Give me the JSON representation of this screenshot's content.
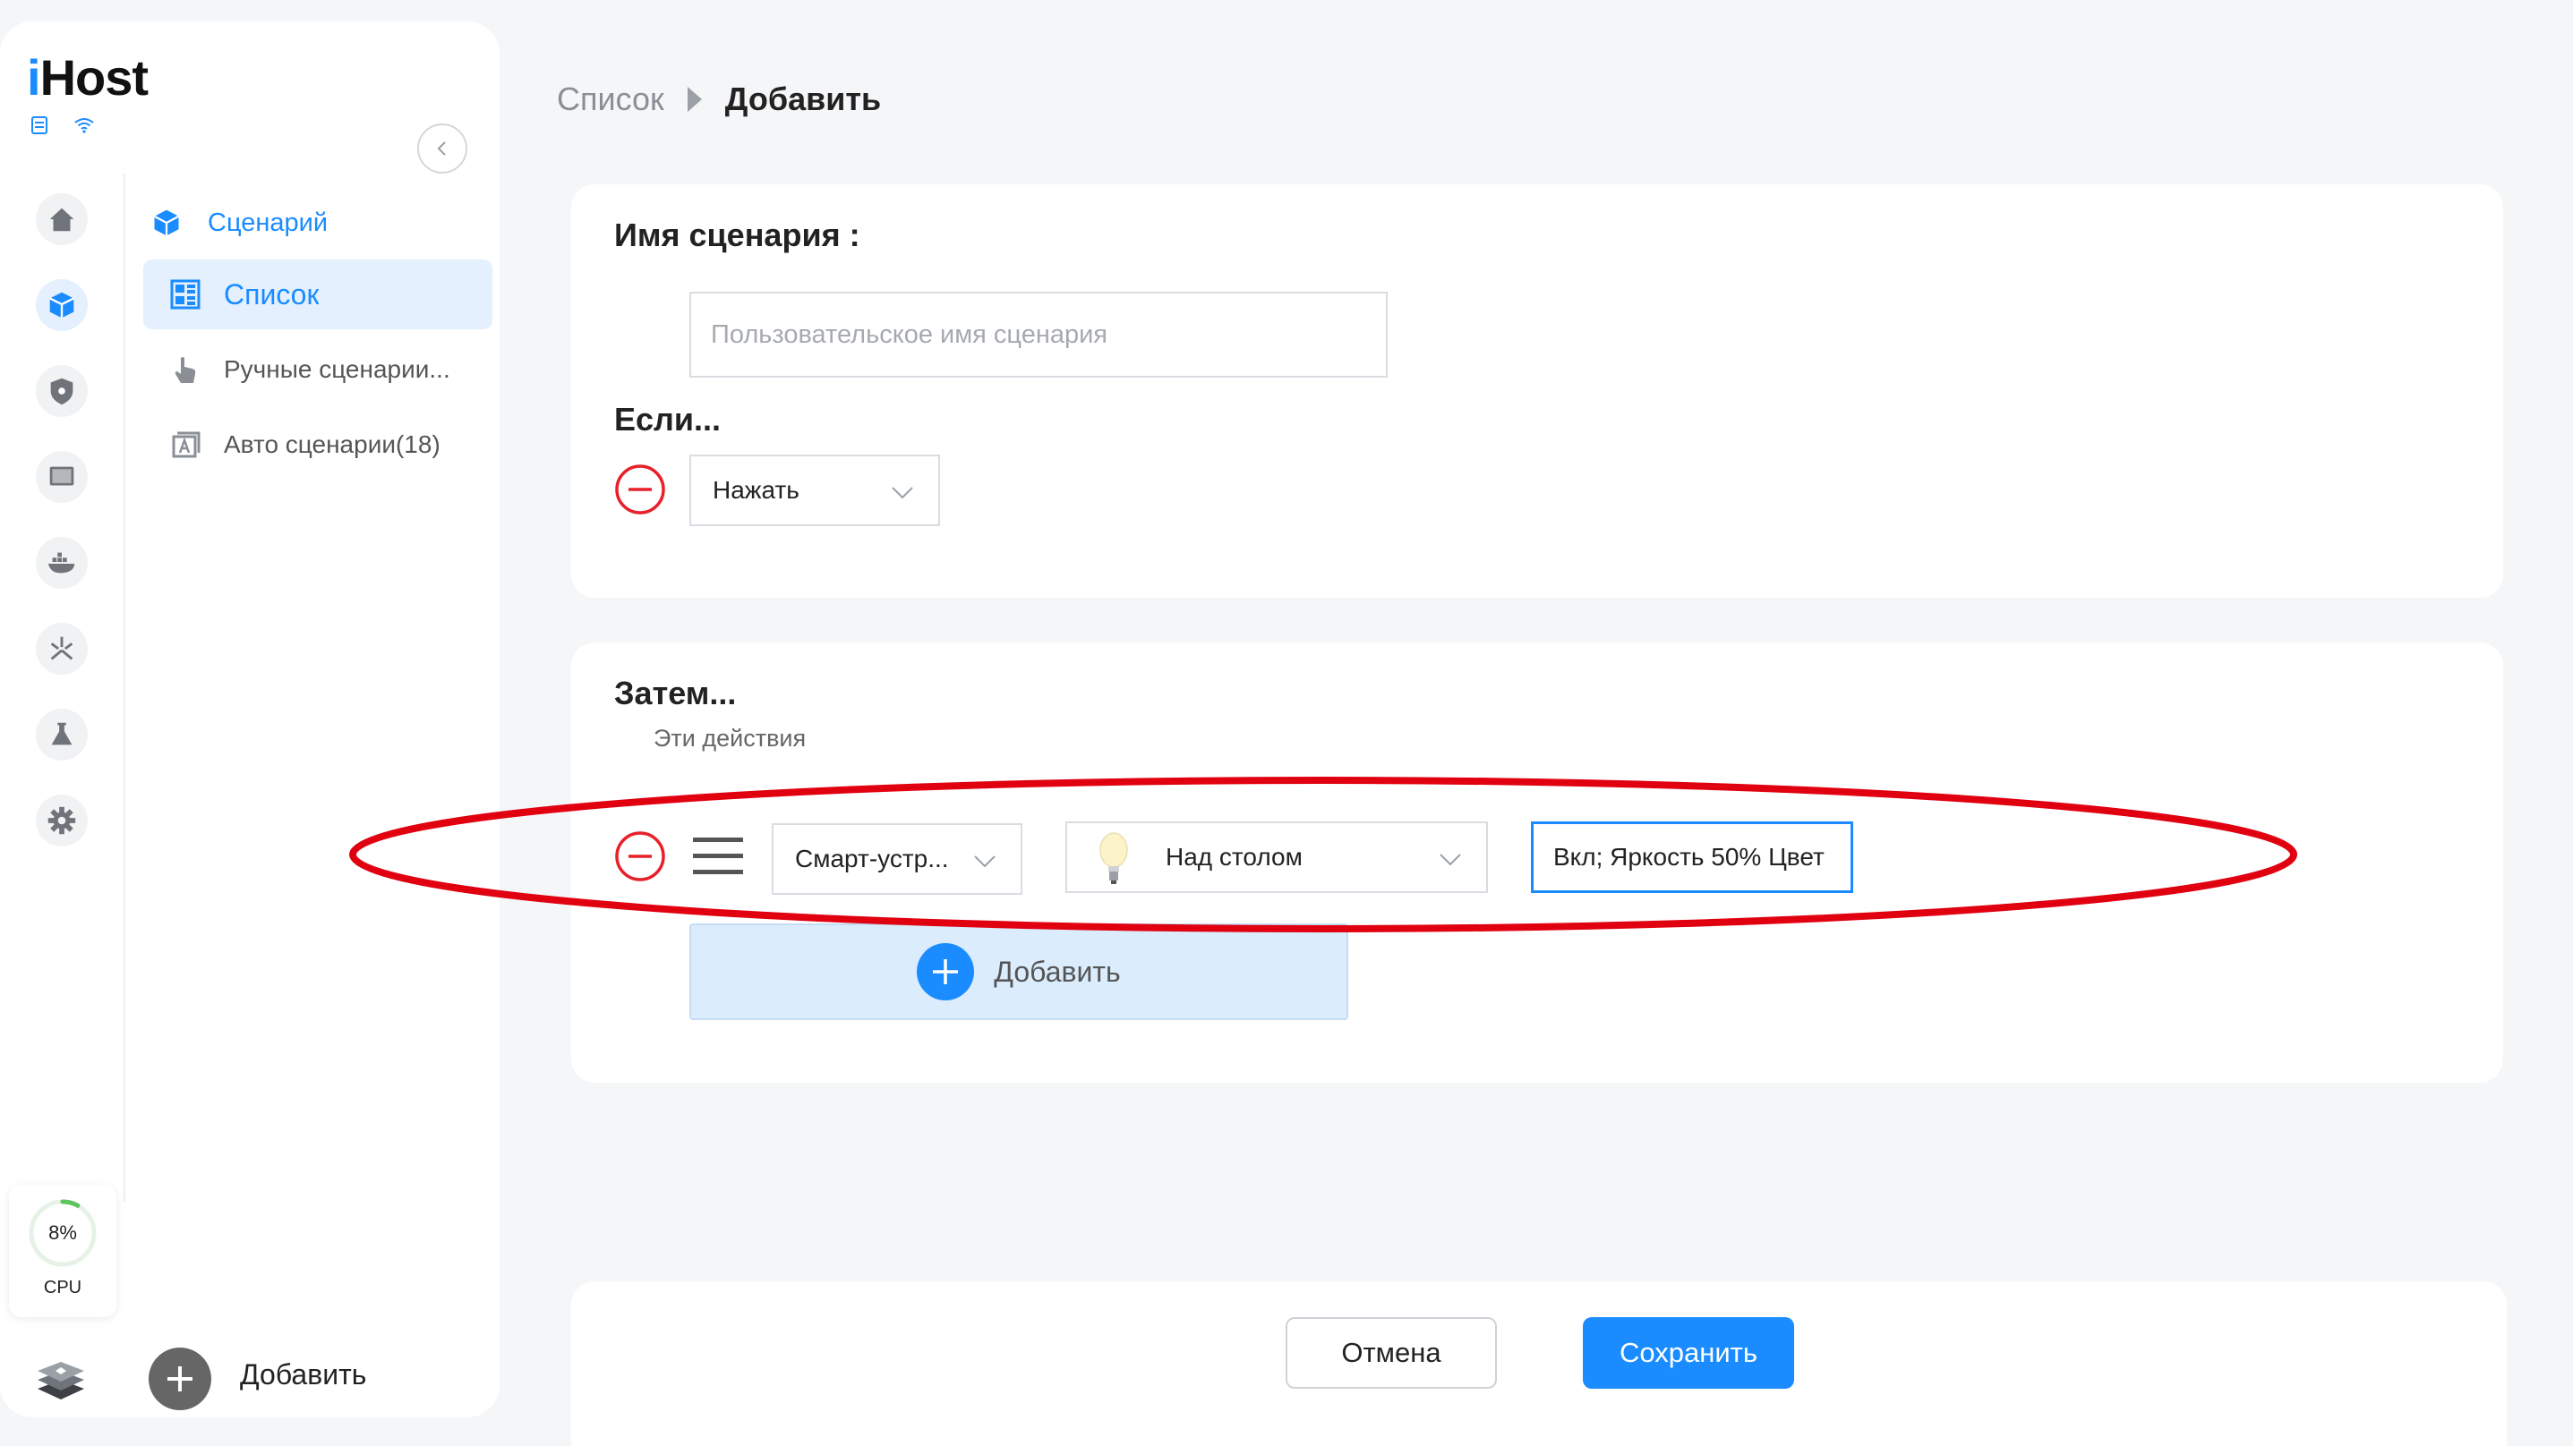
{
  "app": {
    "logo_prefix": "i",
    "logo_rest": "Host",
    "status_icons": [
      "server-icon",
      "wifi-icon"
    ]
  },
  "rail": {
    "items": [
      {
        "icon": "home-icon",
        "active": false
      },
      {
        "icon": "scene-cube-icon",
        "active": true
      },
      {
        "icon": "shield-icon",
        "active": false
      },
      {
        "icon": "screen-icon",
        "active": false
      },
      {
        "icon": "docker-icon",
        "active": false
      },
      {
        "icon": "network-icon",
        "active": false
      },
      {
        "icon": "lab-flask-icon",
        "active": false
      },
      {
        "icon": "gear-icon",
        "active": false
      }
    ]
  },
  "nav": {
    "group_label": "Сценарий",
    "items": [
      {
        "label": "Список",
        "icon": "list-grid-icon",
        "active": true
      },
      {
        "label": "Ручные сценарии...",
        "icon": "hand-pointer-icon",
        "active": false
      },
      {
        "label": "Авто сценарии(18)",
        "icon": "auto-scene-icon",
        "active": false
      }
    ]
  },
  "cpu": {
    "value": "8%",
    "label": "CPU",
    "fraction": 0.08
  },
  "sidebar_add_label": "Добавить",
  "breadcrumb": {
    "root": "Список",
    "current": "Добавить"
  },
  "scene": {
    "name_label": "Имя сценария :",
    "name_value": "",
    "name_placeholder": "Пользовательское имя сценария"
  },
  "condition": {
    "title": "Если...",
    "trigger_value": "Нажать"
  },
  "actions": {
    "title": "Затем...",
    "subtitle": "Эти действия",
    "rows": [
      {
        "type": "Смарт-устр...",
        "device": "Над столом",
        "state": "Вкл; Яркость 50% Цвет"
      }
    ],
    "add_label": "Добавить"
  },
  "footer": {
    "cancel_label": "Отмена",
    "save_label": "Сохранить"
  },
  "colors": {
    "accent": "#1a8cff",
    "danger": "#e8202a",
    "highlight": "#e00010"
  }
}
